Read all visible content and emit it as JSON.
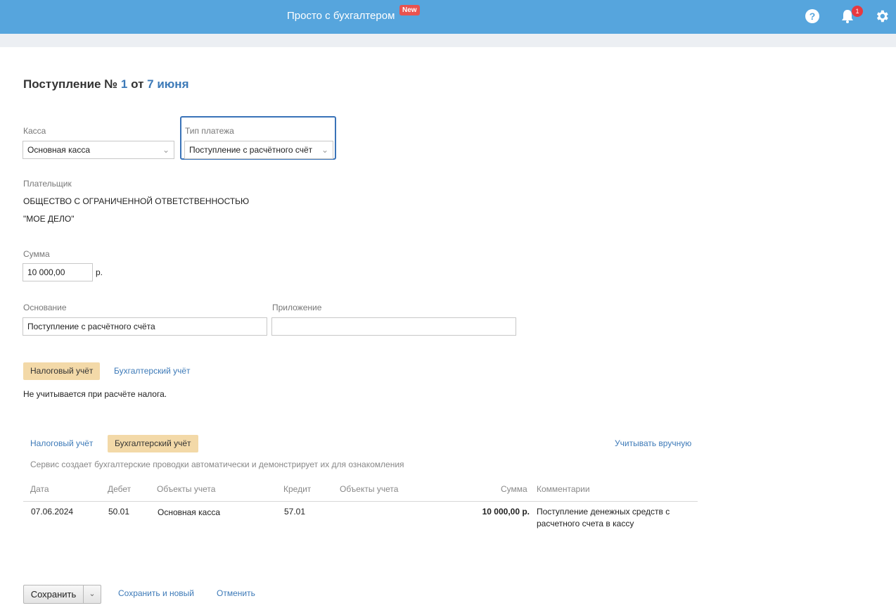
{
  "header": {
    "brand": "Просто с бухгалтером",
    "new_badge": "New",
    "notification_count": "1",
    "icons": [
      "help-icon",
      "bell-icon",
      "gear-icon"
    ],
    "bar_color": "#56a5dd"
  },
  "doc_title": {
    "prefix": "Поступление №",
    "number": "1",
    "from": "от",
    "date": "7 июня"
  },
  "kassa": {
    "label": "Касса",
    "value": "Основная касса"
  },
  "payment_type": {
    "label": "Тип платежа",
    "value": "Поступление с расчётного счёт"
  },
  "payer": {
    "label": "Плательщик",
    "line1": "ОБЩЕСТВО С ОГРАНИЧЕННОЙ ОТВЕТСТВЕННОСТЬЮ",
    "line2": "\"МОЕ ДЕЛО\""
  },
  "sum": {
    "label": "Сумма",
    "value": "10 000,00",
    "currency": "р."
  },
  "basis": {
    "label": "Основание",
    "value": "Поступление с расчётного счёта"
  },
  "attachment": {
    "label": "Приложение",
    "value": ""
  },
  "tabs1": {
    "tax": "Налоговый учёт",
    "accounting": "Бухгалтерский учёт",
    "note": "Не учитывается при расчёте налога."
  },
  "tabs2": {
    "tax": "Налоговый учёт",
    "accounting": "Бухгалтерский учёт",
    "manual": "Учитывать вручную",
    "description": "Сервис создает бухгалтерские проводки автоматически и демонстрирует их для ознакомления"
  },
  "table": {
    "headers": [
      "Дата",
      "Дебет",
      "Объекты учета",
      "Кредит",
      "Объекты учета",
      "Сумма",
      "Комментарии"
    ],
    "rows": [
      {
        "date": "07.06.2024",
        "debit": "50.01",
        "debit_object": "Основная касса",
        "credit": "57.01",
        "credit_object": "",
        "sum": "10 000,00 р.",
        "comment_line1": "Поступление денежных средств с",
        "comment_line2": "расчетного счета в кассу"
      }
    ]
  },
  "footer": {
    "save": "Сохранить",
    "save_new": "Сохранить и новый",
    "cancel": "Отменить"
  }
}
